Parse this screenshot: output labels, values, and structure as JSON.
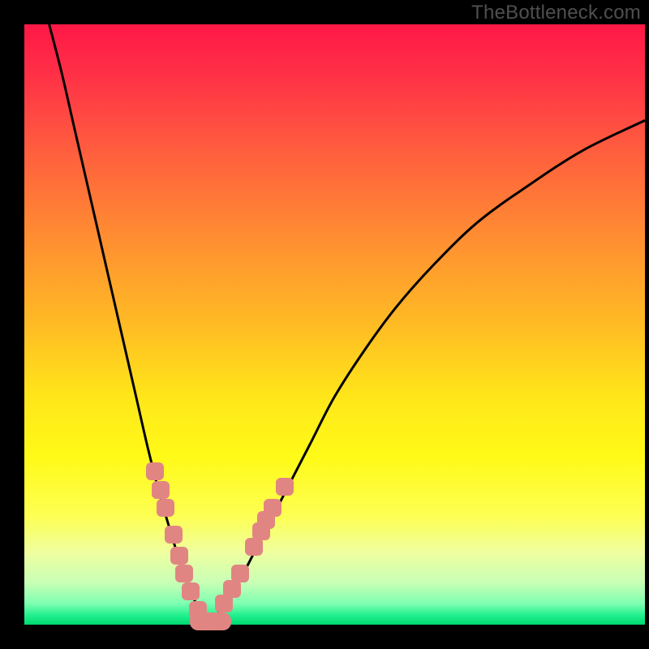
{
  "watermark": "TheBottleneck.com",
  "chart_data": {
    "type": "line",
    "title": "",
    "xlabel": "",
    "ylabel": "",
    "xlim": [
      0,
      100
    ],
    "ylim": [
      0,
      100
    ],
    "series": [
      {
        "name": "left-curve",
        "x": [
          4,
          6,
          8,
          10,
          12,
          14,
          16,
          18,
          20,
          22,
          24,
          25.5,
          27,
          28.5,
          30
        ],
        "y": [
          100,
          92,
          83,
          74,
          65,
          56,
          47,
          38,
          29,
          21,
          14,
          9,
          5,
          2,
          0
        ]
      },
      {
        "name": "right-curve",
        "x": [
          30,
          32,
          35,
          38,
          42,
          46,
          50,
          55,
          60,
          66,
          73,
          81,
          90,
          100
        ],
        "y": [
          0,
          3,
          8,
          14,
          22,
          30,
          38,
          46,
          53,
          60,
          67,
          73,
          79,
          84
        ]
      }
    ],
    "markers": {
      "color": "#e18583",
      "left": [
        {
          "x": 21,
          "y": 25.5
        },
        {
          "x": 21.9,
          "y": 22.5
        },
        {
          "x": 22.7,
          "y": 19.5
        },
        {
          "x": 24,
          "y": 15
        },
        {
          "x": 25,
          "y": 11.5
        },
        {
          "x": 25.8,
          "y": 8.5
        },
        {
          "x": 26.8,
          "y": 5.5
        },
        {
          "x": 28,
          "y": 2.5
        }
      ],
      "right": [
        {
          "x": 32.2,
          "y": 3.5
        },
        {
          "x": 33.5,
          "y": 6
        },
        {
          "x": 34.8,
          "y": 8.5
        },
        {
          "x": 37,
          "y": 13
        },
        {
          "x": 38.2,
          "y": 15.5
        },
        {
          "x": 39,
          "y": 17.5
        },
        {
          "x": 40,
          "y": 19.5
        },
        {
          "x": 42,
          "y": 23
        }
      ],
      "bottom": [
        {
          "x": 29,
          "y": 0.6,
          "wide": true
        },
        {
          "x": 31,
          "y": 0.6,
          "wide": true
        }
      ]
    },
    "gradient_stops": [
      {
        "pos": 0.0,
        "color": "#ff1846"
      },
      {
        "pos": 0.08,
        "color": "#ff2f47"
      },
      {
        "pos": 0.2,
        "color": "#ff5a3f"
      },
      {
        "pos": 0.35,
        "color": "#ff8c32"
      },
      {
        "pos": 0.5,
        "color": "#ffbb24"
      },
      {
        "pos": 0.62,
        "color": "#ffe61a"
      },
      {
        "pos": 0.72,
        "color": "#fffa17"
      },
      {
        "pos": 0.82,
        "color": "#fdff54"
      },
      {
        "pos": 0.88,
        "color": "#efffa0"
      },
      {
        "pos": 0.93,
        "color": "#c8ffb5"
      },
      {
        "pos": 0.965,
        "color": "#7dffb1"
      },
      {
        "pos": 0.985,
        "color": "#1fef8e"
      },
      {
        "pos": 1.0,
        "color": "#00d86e"
      }
    ]
  }
}
